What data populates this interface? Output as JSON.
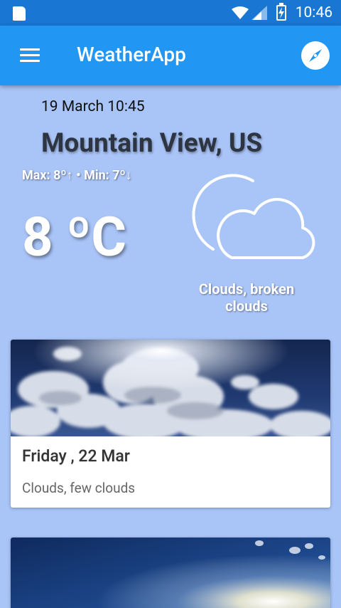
{
  "status_bar": {
    "time": "10:46"
  },
  "app_bar": {
    "title": "WeatherApp"
  },
  "current": {
    "date": "19 March 10:45",
    "city": "Mountain View, US",
    "max_min": "Max: 8º↑ •  Min: 7º↓",
    "temperature": "8 ºC",
    "description": "Clouds, broken clouds"
  },
  "forecast": [
    {
      "day": "Friday , 22 Mar",
      "description": "Clouds, few clouds"
    },
    {
      "day": "",
      "description": ""
    }
  ],
  "colors": {
    "primary": "#2196f3",
    "primary_dark": "#1976d2",
    "background": "#a9c4f7"
  }
}
